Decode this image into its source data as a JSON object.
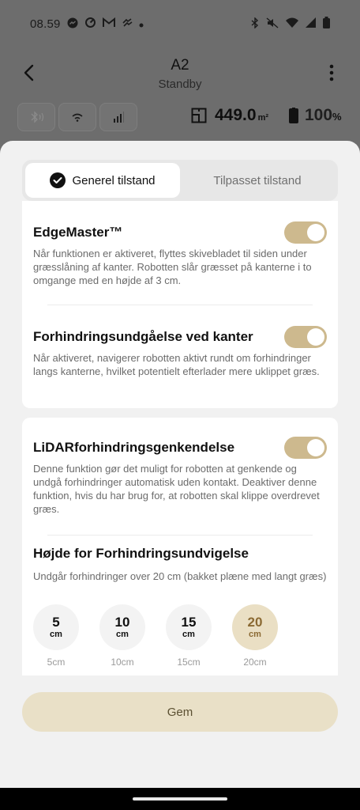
{
  "status_bar": {
    "time": "08.59",
    "left_icons": [
      "messenger-icon",
      "sync-icon",
      "gmail-icon",
      "app-icon",
      "dot-icon"
    ],
    "right_icons": [
      "bluetooth-icon",
      "mute-icon",
      "wifi-icon",
      "signal-icon",
      "battery-icon"
    ]
  },
  "header": {
    "title": "A2",
    "subtitle": "Standby"
  },
  "info": {
    "area_value": "449.0",
    "area_unit": "m²",
    "battery_value": "100",
    "battery_unit": "%"
  },
  "tabs": [
    {
      "label": "Generel tilstand",
      "active": true
    },
    {
      "label": "Tilpasset tilstand",
      "active": false
    }
  ],
  "settings": {
    "edgemaster": {
      "title": "EdgeMaster™",
      "description": "Når funktionen er aktiveret, flyttes skivebladet til siden under græsslåning af kanter. Robotten slår græsset på kanterne i to omgange med en højde af 3 cm.",
      "enabled": true
    },
    "edge_avoidance": {
      "title": "Forhindringsundgåelse ved kanter",
      "description": "Når aktiveret, navigerer robotten aktivt rundt om forhindringer langs kanterne, hvilket potentielt efterlader mere uklippet græs.",
      "enabled": true
    },
    "lidar": {
      "title": "LiDARforhindringsgenkendelse",
      "description": "Denne funktion gør det muligt for robotten at genkende og undgå forhindringer automatisk uden kontakt. Deaktiver denne funktion, hvis du har brug for, at robotten skal klippe overdrevet græs.",
      "enabled": true
    },
    "avoid_height": {
      "title": "Højde for Forhindringsundvigelse",
      "description": "Undgår forhindringer over 20 cm (bakket plæne med langt græs)",
      "options": [
        {
          "num": "5",
          "unit": "cm",
          "label": "5cm",
          "selected": false
        },
        {
          "num": "10",
          "unit": "cm",
          "label": "10cm",
          "selected": false
        },
        {
          "num": "15",
          "unit": "cm",
          "label": "15cm",
          "selected": false
        },
        {
          "num": "20",
          "unit": "cm",
          "label": "20cm",
          "selected": true
        }
      ]
    }
  },
  "save_label": "Gem",
  "colors": {
    "accent": "#cdb98e",
    "selected_bg": "#eadfc4",
    "selected_text": "#8b6a33",
    "save_bg": "#e9e0c7"
  }
}
